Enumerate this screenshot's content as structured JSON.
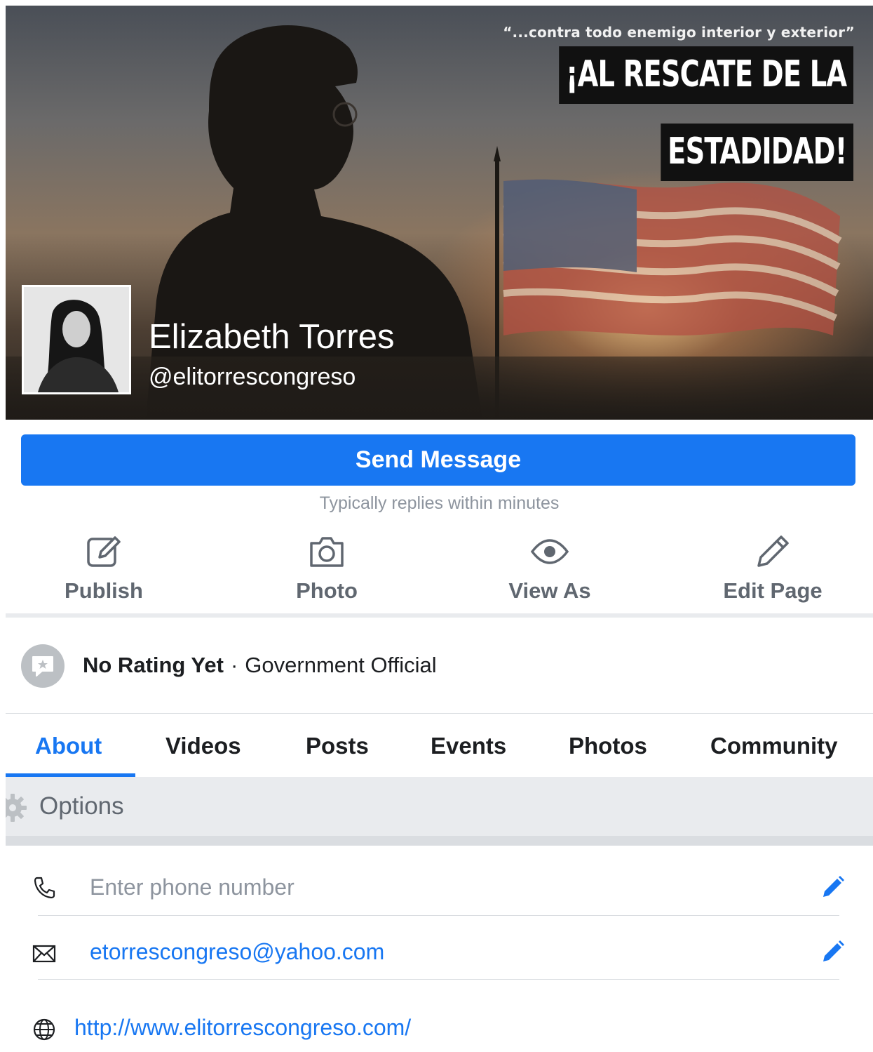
{
  "cover": {
    "quote": "“...contra todo enemigo interior y exterior”",
    "banner_line1": "¡AL RESCATE DE LA",
    "banner_line2": "ESTADIDAD!"
  },
  "profile": {
    "name": "Elizabeth Torres",
    "handle": "@elitorrescongreso"
  },
  "primary_action": {
    "label": "Send Message",
    "note": "Typically replies within minutes"
  },
  "actions": [
    {
      "label": "Publish",
      "icon": "compose-icon"
    },
    {
      "label": "Photo",
      "icon": "camera-icon"
    },
    {
      "label": "View As",
      "icon": "eye-icon"
    },
    {
      "label": "Edit Page",
      "icon": "pencil-icon"
    }
  ],
  "rating": {
    "status": "No Rating Yet",
    "separator": "·",
    "category": "Government Official"
  },
  "tabs": [
    {
      "label": "About",
      "active": true
    },
    {
      "label": "Videos"
    },
    {
      "label": "Posts"
    },
    {
      "label": "Events"
    },
    {
      "label": "Photos"
    },
    {
      "label": "Community"
    }
  ],
  "options": {
    "label": "Options"
  },
  "contact": {
    "phone_placeholder": "Enter phone number",
    "email": "etorrescongreso@yahoo.com",
    "website": "http://www.elitorrescongreso.com/"
  },
  "colors": {
    "accent": "#1877f2",
    "secondary_text": "#606770",
    "muted_text": "#8d949e"
  }
}
